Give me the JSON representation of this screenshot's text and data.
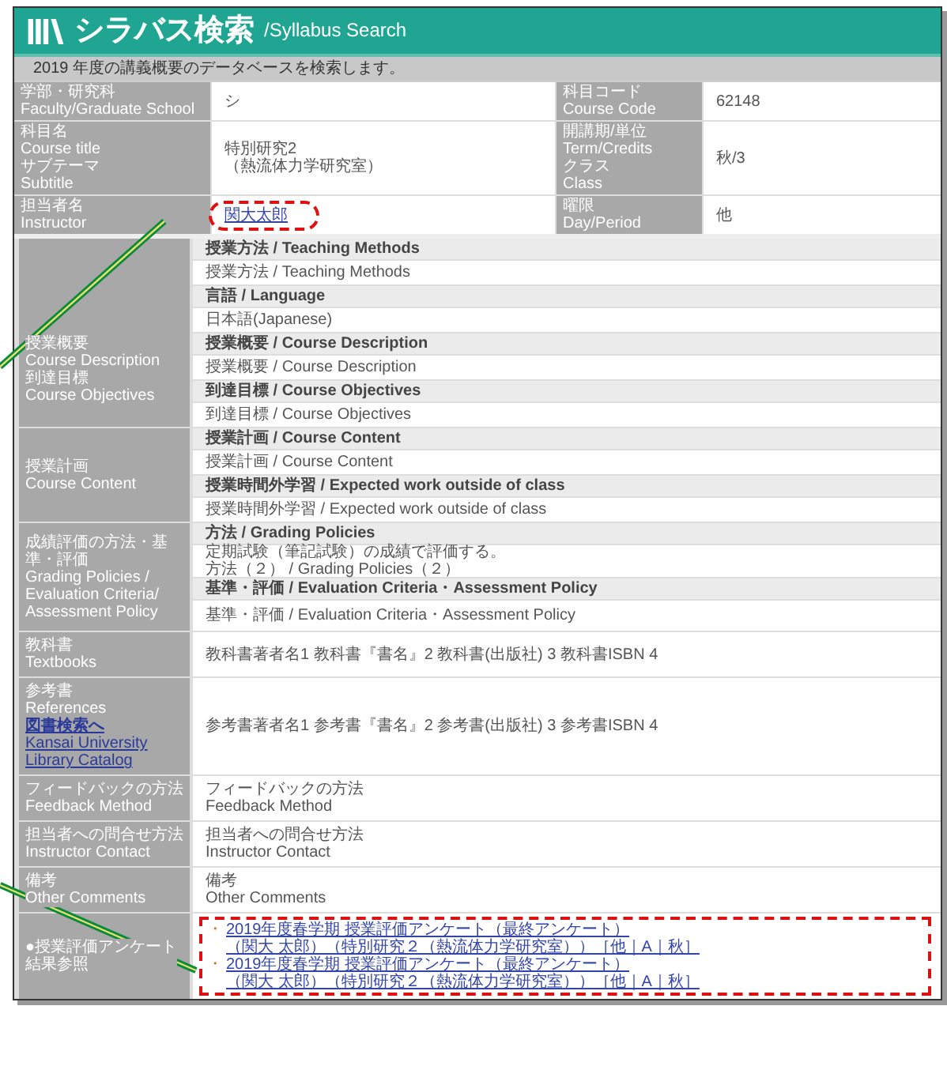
{
  "header": {
    "title": "シラバス検索",
    "subtitle": "/Syllabus Search"
  },
  "notice": "2019 年度の講義概要のデータベースを検索します。",
  "info_rows": [
    {
      "labels": [
        "学部・研究科",
        "Faculty/Graduate School"
      ],
      "value": {
        "kind": "text",
        "lines": [
          "シ"
        ]
      },
      "labels2": [
        "科目コード",
        "Course Code"
      ],
      "value2": [
        "62148"
      ]
    },
    {
      "labels": [
        "科目名",
        "Course title",
        "サブテーマ",
        "Subtitle"
      ],
      "value": {
        "kind": "text",
        "lines": [
          "特別研究2",
          "（熱流体力学研究室）"
        ]
      },
      "labels2": [
        "開講期/単位",
        "Term/Credits",
        "クラス",
        "Class"
      ],
      "value2": [
        "秋/3"
      ]
    },
    {
      "labels": [
        "担当者名",
        "Instructor"
      ],
      "value": {
        "kind": "link",
        "text": "関大太郎",
        "highlighted": true
      },
      "labels2": [
        "曜限",
        "Day/Period"
      ],
      "value2": [
        "他"
      ]
    }
  ],
  "sections": [
    {
      "label_lines": [
        "授業概要",
        "Course Description",
        "到達目標",
        "Course Objectives"
      ],
      "items": [
        {
          "kind": "heading",
          "text": "授業方法 / Teaching Methods"
        },
        {
          "kind": "content",
          "lines": [
            "授業方法 / Teaching Methods"
          ]
        },
        {
          "kind": "heading",
          "text": "言語 / Language"
        },
        {
          "kind": "content",
          "lines": [
            "日本語(Japanese)"
          ]
        },
        {
          "kind": "heading",
          "text": "授業概要 / Course Description"
        },
        {
          "kind": "content",
          "lines": [
            "授業概要 / Course Description"
          ]
        },
        {
          "kind": "heading",
          "text": "到達目標 / Course Objectives"
        },
        {
          "kind": "content",
          "lines": [
            "到達目標 / Course Objectives"
          ]
        }
      ]
    },
    {
      "label_lines": [
        "授業計画",
        "Course Content"
      ],
      "items": [
        {
          "kind": "heading",
          "text": "授業計画 / Course Content"
        },
        {
          "kind": "content",
          "lines": [
            "授業計画 / Course Content"
          ]
        },
        {
          "kind": "heading",
          "text": "授業時間外学習 / Expected work outside of class"
        },
        {
          "kind": "content",
          "lines": [
            "授業時間外学習 / Expected work outside of class"
          ]
        }
      ]
    },
    {
      "label_lines": [
        "成績評価の方法・基準・評価",
        "Grading Policies / Evaluation Criteria/ Assessment Policy"
      ],
      "items": [
        {
          "kind": "heading",
          "text": "方法 / Grading Policies"
        },
        {
          "kind": "content",
          "lines": [
            "定期試験（筆記試験）の成績で評価する。",
            "方法（２） / Grading Policies（２）"
          ]
        },
        {
          "kind": "heading",
          "text": "基準・評価 / Evaluation Criteria・Assessment Policy"
        },
        {
          "kind": "content",
          "lines": [
            "基準・評価 / Evaluation Criteria・Assessment Policy"
          ]
        }
      ]
    },
    {
      "label_lines": [
        "教科書",
        "Textbooks"
      ],
      "items": [
        {
          "kind": "content",
          "lines": [
            "教科書著者名1 教科書『書名』2 教科書(出版社) 3 教科書ISBN 4"
          ]
        }
      ]
    },
    {
      "label_lines": [
        "参考書",
        "References"
      ],
      "label_links": [
        "**図書検索へ**",
        "Kansai University Library Catalog"
      ],
      "items": [
        {
          "kind": "content",
          "lines": [
            "参考書著者名1 参考書『書名』2 参考書(出版社) 3 参考書ISBN 4"
          ]
        }
      ]
    },
    {
      "label_lines": [
        "フィードバックの方法",
        "Feedback Method"
      ],
      "items": [
        {
          "kind": "content",
          "lines": [
            "フィードバックの方法",
            "Feedback Method"
          ]
        }
      ]
    },
    {
      "label_lines": [
        "担当者への問合せ方法",
        "Instructor Contact"
      ],
      "items": [
        {
          "kind": "content",
          "lines": [
            "担当者への問合せ方法",
            "Instructor Contact"
          ]
        }
      ]
    },
    {
      "label_lines": [
        "備考",
        "Other Comments"
      ],
      "items": [
        {
          "kind": "content",
          "lines": [
            "備考",
            "Other Comments"
          ]
        }
      ]
    },
    {
      "label_lines": [
        "●授業評価アンケート",
        "結果参照"
      ],
      "items": [
        {
          "kind": "links",
          "highlighted": true,
          "links": [
            {
              "marker": "・",
              "lines": [
                "2019年度春学期 授業評価アンケート（最終アンケート）",
                "（関大 太郎）（特別研究２（熱流体力学研究室））［他｜A｜秋］"
              ]
            },
            {
              "marker": "・",
              "lines": [
                "2019年度春学期 授業評価アンケート（最終アンケート）",
                "（関大 太郎）（特別研究２（熱流体力学研究室））［他｜A｜秋］"
              ]
            }
          ]
        }
      ]
    }
  ]
}
